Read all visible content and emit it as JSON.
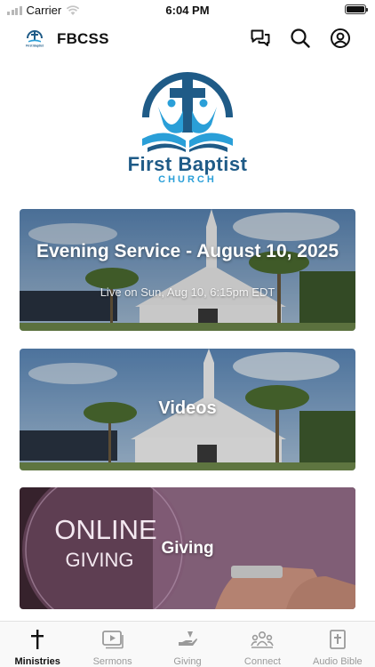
{
  "status_bar": {
    "carrier": "Carrier",
    "time": "6:04 PM"
  },
  "header": {
    "title": "FBCSS",
    "logo_caption": "First Baptist"
  },
  "logo": {
    "line1": "First Baptist",
    "line2": "CHURCH"
  },
  "cards": [
    {
      "title": "Evening Service - August 10, 2025",
      "subtitle": "Live on Sun, Aug 10, 6:15pm EDT"
    },
    {
      "title": "Videos"
    },
    {
      "title": "Giving",
      "image_text_1": "ONLINE",
      "image_text_2": "GIVING"
    }
  ],
  "tabs": [
    {
      "label": "Ministries",
      "icon": "cross-icon",
      "active": true
    },
    {
      "label": "Sermons",
      "icon": "video-play-icon",
      "active": false
    },
    {
      "label": "Giving",
      "icon": "giving-hand-icon",
      "active": false
    },
    {
      "label": "Connect",
      "icon": "people-group-icon",
      "active": false
    },
    {
      "label": "Audio Bible",
      "icon": "bible-icon",
      "active": false
    }
  ],
  "colors": {
    "brand_dark": "#1f5b87",
    "brand_light": "#2a9fd8",
    "accent_sky": "#5a87b8",
    "active_tab": "#111111",
    "inactive_tab": "#9a9a9a"
  }
}
